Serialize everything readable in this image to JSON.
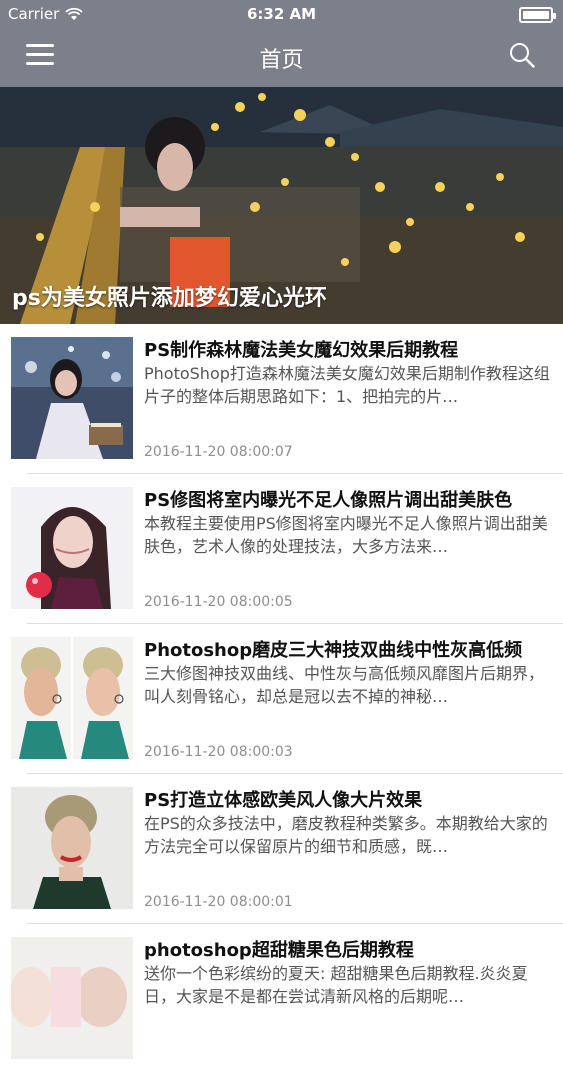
{
  "status_bar": {
    "carrier": "Carrier",
    "time": "6:32 AM"
  },
  "nav": {
    "title": "首页",
    "menu_icon": "hamburger-menu-icon",
    "search_icon": "search-icon"
  },
  "banner": {
    "caption": "ps为美女照片添加梦幻爱心光环"
  },
  "articles": [
    {
      "title": "PS制作森林魔法美女魔幻效果后期教程",
      "desc": "PhotoShop打造森林魔法美女魔幻效果后期制作教程这组片子的整体后期思路如下：1、把拍完的片…",
      "date": "2016-11-20 08:00:07"
    },
    {
      "title": "PS修图将室内曝光不足人像照片调出甜美肤色",
      "desc": "本教程主要使用PS修图将室内曝光不足人像照片调出甜美肤色，艺术人像的处理技法，大多方法来…",
      "date": "2016-11-20 08:00:05"
    },
    {
      "title": "Photoshop磨皮三大神技双曲线中性灰高低频",
      "desc": "三大修图神技双曲线、中性灰与高低频风靡图片后期界，叫人刻骨铭心，却总是冠以去不掉的神秘…",
      "date": "2016-11-20 08:00:03"
    },
    {
      "title": "PS打造立体感欧美风人像大片效果",
      "desc": "在PS的众多技法中，磨皮教程种类繁多。本期教给大家的方法完全可以保留原片的细节和质感，既…",
      "date": "2016-11-20 08:00:01"
    },
    {
      "title": "photoshop超甜糖果色后期教程",
      "desc": "送你一个色彩缤纷的夏天: 超甜糖果色后期教程.炎炎夏日，大家是不是都在尝试清新风格的后期呢…",
      "date": ""
    }
  ]
}
